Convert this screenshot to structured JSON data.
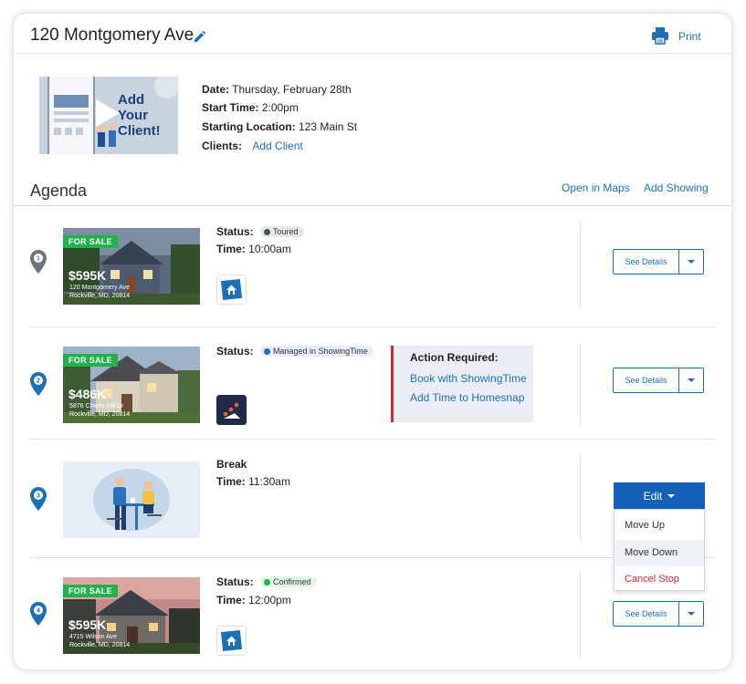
{
  "header": {
    "title": "120 Montgomery Ave",
    "print_label": "Print"
  },
  "tour": {
    "video_text": "Add Your Client!",
    "date_label": "Date:",
    "date_value": "Thursday, February 28th",
    "start_label": "Start Time:",
    "start_value": "2:00pm",
    "location_label": "Starting Location:",
    "location_value": "123 Main St",
    "clients_label": "Clients:",
    "add_client": "Add Client"
  },
  "agenda": {
    "title": "Agenda",
    "open_maps": "Open in Maps",
    "add_showing": "Add Showing"
  },
  "stops": [
    {
      "number": "1",
      "for_sale": "FOR SALE",
      "price": "$595K",
      "address1": "120 Montgomery Ave",
      "address2": "Rockville, MD, 20814",
      "status_label": "Status:",
      "status": "Toured",
      "time_label": "Time:",
      "time": "10:00am",
      "details": "See Details"
    },
    {
      "number": "2",
      "for_sale": "FOR SALE",
      "price": "$486K",
      "address1": "5876 Cherry Hill Dr",
      "address2": "Rockville, MD, 20814",
      "status_label": "Status:",
      "status": "Managed in ShowingTime",
      "details": "See Details",
      "action_title": "Action Required:",
      "action_link1": "Book with ShowingTime",
      "action_link2": "Add Time to Homesnap"
    },
    {
      "number": "3",
      "title": "Break",
      "time_label": "Time:",
      "time": "11:30am",
      "edit": "Edit",
      "menu": [
        "Move Up",
        "Move Down",
        "Cancel Stop"
      ]
    },
    {
      "number": "4",
      "for_sale": "FOR SALE",
      "price": "$595K",
      "address1": "4715 Wilson Ave",
      "address2": "Rockville, MD, 20814",
      "status_label": "Status:",
      "status": "Confirmed",
      "time_label": "Time:",
      "time": "12:00pm",
      "details": "See Details"
    }
  ],
  "colors": {
    "accent": "#1d6fb8",
    "primary_button": "#1560b8",
    "for_sale": "#22b14c",
    "danger": "#d9262b"
  }
}
